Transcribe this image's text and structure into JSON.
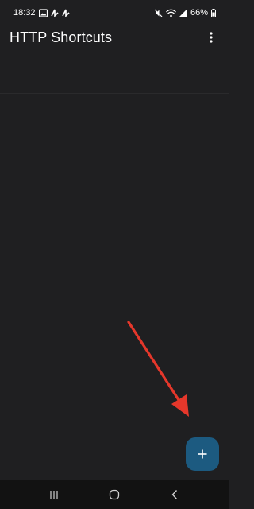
{
  "status_bar": {
    "time": "18:32",
    "battery_percent": "66%",
    "left_icons": [
      "image-icon",
      "threads-icon",
      "threads-icon"
    ],
    "right_icons": [
      "mute-icon",
      "wifi-icon",
      "signal-icon",
      "battery-icon"
    ]
  },
  "app_bar": {
    "title": "HTTP Shortcuts",
    "overflow_icon": "more-vert-icon"
  },
  "fab": {
    "icon": "plus-icon",
    "color": "#1c5a80"
  },
  "annotation": {
    "color": "#e5372b",
    "icon": "red-arrow"
  },
  "nav_bar": {
    "buttons": [
      "recent-apps-icon",
      "home-icon",
      "back-icon"
    ]
  },
  "colors": {
    "background": "#1f1f21",
    "nav_background": "#121212"
  }
}
